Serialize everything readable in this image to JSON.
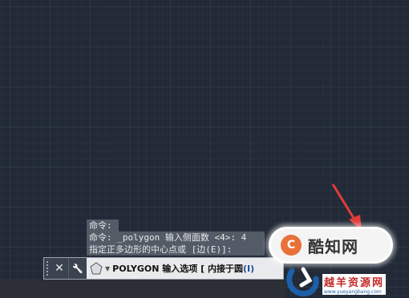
{
  "command_history": [
    "命令:",
    "命令: _polygon 输入侧面数 <4>: 4",
    "指定正多边形的中心点或 [边(E)]:"
  ],
  "command_line": {
    "command": "POLYGON",
    "prompt": "输入选项",
    "options_prefix": "[",
    "option_label": "内接于圆",
    "option_key": "(I)",
    "close_label": "✕",
    "customize_label": "🔧"
  },
  "badge": {
    "logo": "C",
    "text": "酷知网"
  },
  "watermark": {
    "name": "越羊资源网",
    "url": "www.yueyangbang.com"
  },
  "colors": {
    "canvas_bg": "#222a37",
    "arrow": "#e23c3c",
    "history_bg": "#5a626e",
    "bar_bg": "#e9eaec"
  },
  "icons": {
    "close": "close-icon",
    "customize": "wrench-icon",
    "command": "polygon-icon"
  }
}
